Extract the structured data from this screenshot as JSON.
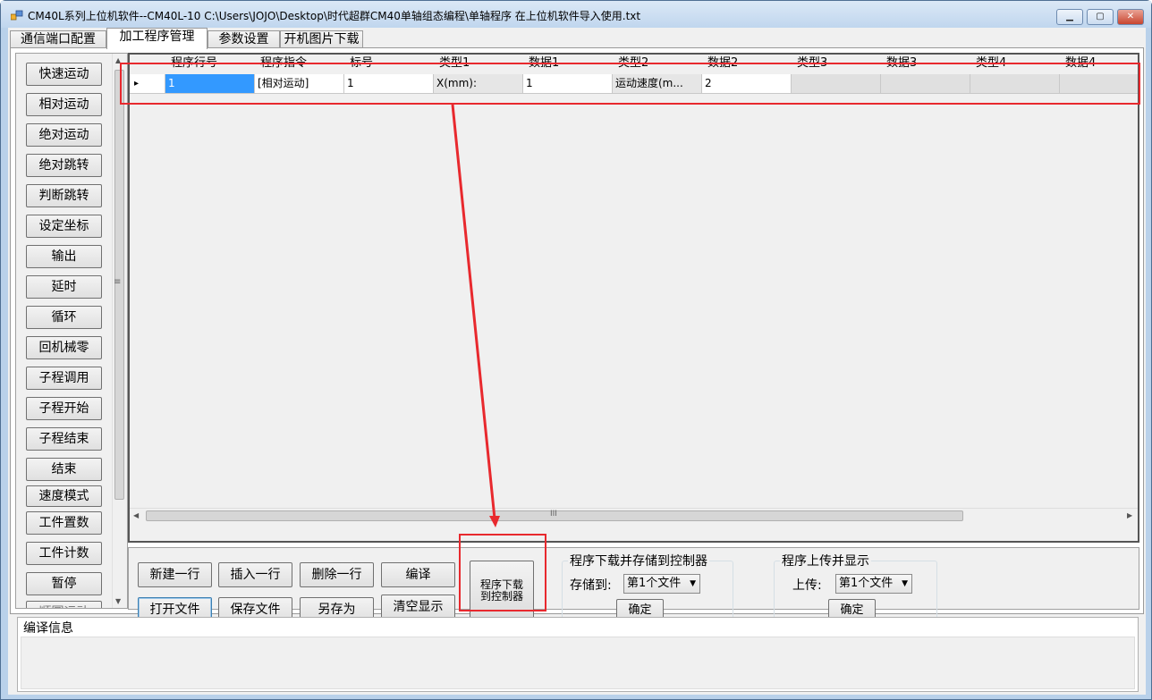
{
  "window": {
    "title": "CM40L系列上位机软件--CM40L-10    C:\\Users\\JOJO\\Desktop\\时代超群CM40单轴组态编程\\单轴程序 在上位机软件导入使用.txt",
    "minimize_icon": "minimize-icon",
    "maximize_icon": "maximize-icon",
    "close_icon": "close-icon"
  },
  "tabs": [
    "通信端口配置",
    "加工程序管理",
    "参数设置",
    "开机图片下载"
  ],
  "active_tab": 1,
  "sidebar": {
    "buttons": [
      "快速运动",
      "相对运动",
      "绝对运动",
      "绝对跳转",
      "判断跳转",
      "设定坐标",
      "输出",
      "延时",
      "循环",
      "回机械零",
      "子程调用",
      "子程开始",
      "子程结束",
      "结束",
      "速度模式",
      "工件置数",
      "工件计数",
      "暂停",
      "顺圆运动"
    ],
    "scroll_mark": "≡"
  },
  "grid": {
    "columns": [
      "程序行号",
      "程序指令",
      "标号",
      "类型1",
      "数据1",
      "类型2",
      "数据2",
      "类型3",
      "数据3",
      "类型4",
      "数据4"
    ],
    "row": [
      "1",
      "[相对运动]",
      "1",
      "X(mm):",
      "1",
      "运动速度(m...",
      "2",
      "",
      "",
      "",
      ""
    ],
    "row_marker": "▸",
    "hscroll_mark": "III"
  },
  "actions": {
    "new_row": "新建一行",
    "insert_row": "插入一行",
    "delete_row": "删除一行",
    "compile": "编译",
    "open_file": "打开文件",
    "save_file": "保存文件",
    "save_as": "另存为",
    "clear_display": "清空显示",
    "download_line1": "程序下载",
    "download_line2": "到控制器"
  },
  "download_group": {
    "title": "程序下载并存储到控制器",
    "label": "存储到:",
    "selected": "第1个文件",
    "ok": "确定"
  },
  "upload_group": {
    "title": "程序上传并显示",
    "label": "上传:",
    "selected": "第1个文件",
    "ok": "确定"
  },
  "compile_info": {
    "title": "编译信息"
  },
  "annotation": {
    "color": "#e8292e"
  }
}
